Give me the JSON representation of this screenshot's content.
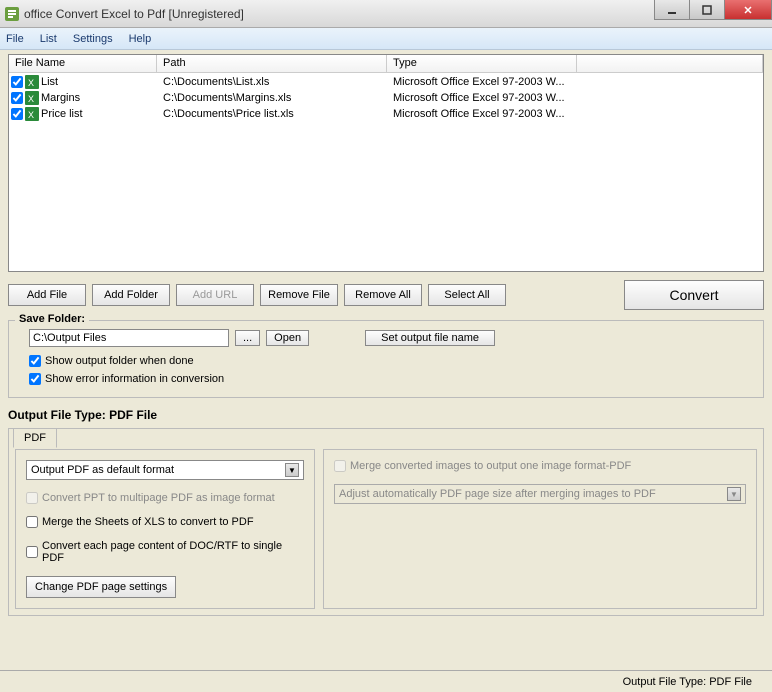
{
  "window": {
    "title": "office Convert Excel to Pdf [Unregistered]"
  },
  "menu": {
    "file": "File",
    "list": "List",
    "settings": "Settings",
    "help": "Help"
  },
  "columns": {
    "fname": "File Name",
    "path": "Path",
    "type": "Type"
  },
  "files": [
    {
      "name": "List",
      "path": "C:\\Documents\\List.xls",
      "type": "Microsoft Office Excel 97-2003 W..."
    },
    {
      "name": "Margins",
      "path": "C:\\Documents\\Margins.xls",
      "type": "Microsoft Office Excel 97-2003 W..."
    },
    {
      "name": "Price list",
      "path": "C:\\Documents\\Price list.xls",
      "type": "Microsoft Office Excel 97-2003 W..."
    }
  ],
  "buttons": {
    "addFile": "Add File",
    "addFolder": "Add Folder",
    "addUrl": "Add URL",
    "removeFile": "Remove File",
    "removeAll": "Remove All",
    "selectAll": "Select All",
    "convert": "Convert"
  },
  "save": {
    "legend": "Save Folder:",
    "path": "C:\\Output Files",
    "browse": "...",
    "open": "Open",
    "setOutput": "Set output file name",
    "showFolder": "Show output folder when done",
    "showError": "Show error information in conversion"
  },
  "outType": {
    "label": "Output File Type:  PDF File"
  },
  "tab": {
    "pdf": "PDF"
  },
  "pdfPanel": {
    "format": "Output PDF as default format",
    "convertPpt": "Convert PPT to multipage PDF as image format",
    "mergeSheets": "Merge the Sheets of XLS to convert to PDF",
    "eachPage": "Convert each page content of DOC/RTF to single PDF",
    "settingsBtn": "Change PDF page settings"
  },
  "rightPanel": {
    "merge": "Merge converted images to output one image format-PDF",
    "adjust": "Adjust automatically PDF page size after merging images to PDF"
  },
  "status": "Output File Type:  PDF File"
}
